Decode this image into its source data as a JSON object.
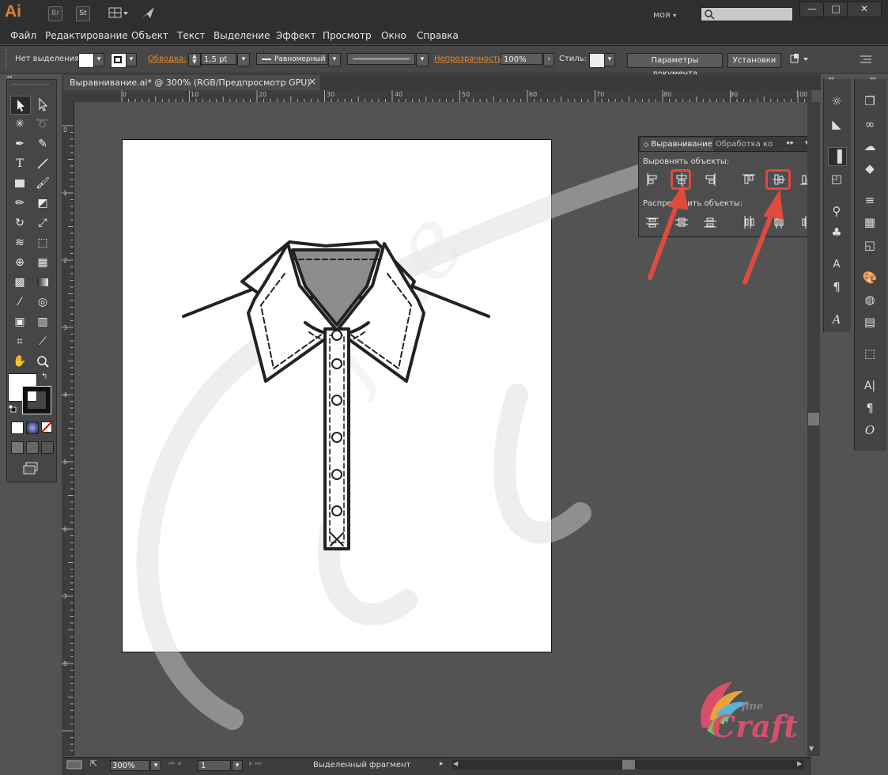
{
  "titlebar": {
    "app": "Ai",
    "br": "Br",
    "st": "St",
    "workspace": "моя",
    "win_min": "—",
    "win_max": "□",
    "win_close": "✕"
  },
  "menu": [
    "Файл",
    "Редактирование",
    "Объект",
    "Текст",
    "Выделение",
    "Эффект",
    "Просмотр",
    "Окно",
    "Справка"
  ],
  "controlbar": {
    "no_selection": "Нет выделения",
    "stroke_label": "Обводка:",
    "stroke_value": "1,5 pt",
    "stroke_profile": "Равномерный",
    "opacity_label": "Непрозрачность:",
    "opacity_value": "100%",
    "style_label": "Стиль:",
    "doc_params": "Параметры документа",
    "settings": "Установки"
  },
  "document": {
    "tab_title": "Выравнивание.ai* @ 300% (RGB/Предпросмотр GPU)",
    "close": "×"
  },
  "ruler": {
    "h_ticks": [
      "0",
      "10",
      "20",
      "30",
      "40",
      "50",
      "60",
      "70",
      "80",
      "90",
      "100"
    ],
    "v_ticks": [
      "0",
      "1",
      "2",
      "3",
      "4",
      "5",
      "6",
      "7",
      "8"
    ]
  },
  "align_panel": {
    "tab_active": "Выравнивание",
    "tab_other": "Обработка ко",
    "align_objects": "Выровнять объекты:",
    "distribute_objects": "Распределить объекты:",
    "highlight_color": "#e04a3f"
  },
  "statusbar": {
    "zoom": "300%",
    "page": "1",
    "status_text": "Выделенный фрагмент"
  },
  "watermark": {
    "brand_small": "fine",
    "brand_big": "Craft"
  }
}
